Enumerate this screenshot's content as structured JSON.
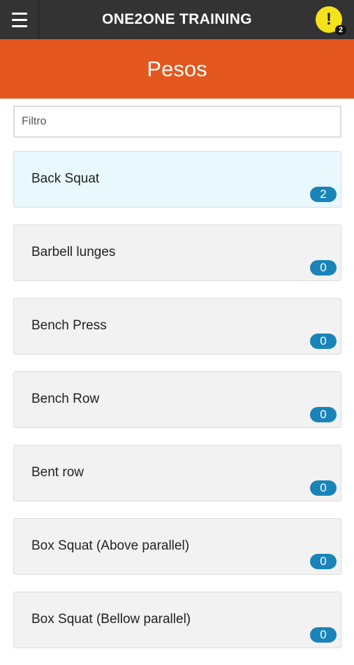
{
  "topbar": {
    "title": "ONE2ONE TRAINING",
    "menu_icon": "hamburger-icon",
    "alert_icon": "exclamation-icon",
    "alert_symbol": "!",
    "alert_count": "2",
    "background_color": "#333333",
    "alert_color": "#f5e21a"
  },
  "header": {
    "title": "Pesos",
    "background_color": "#e4571e"
  },
  "filter": {
    "placeholder": "Filtro",
    "value": ""
  },
  "exercises": [
    {
      "name": "Back Squat",
      "count": "2",
      "highlighted": true
    },
    {
      "name": "Barbell lunges",
      "count": "0"
    },
    {
      "name": "Bench Press",
      "count": "0"
    },
    {
      "name": "Bench Row",
      "count": "0"
    },
    {
      "name": "Bent row",
      "count": "0"
    },
    {
      "name": "Box Squat (Above parallel)",
      "count": "0"
    },
    {
      "name": "Box Squat (Bellow parallel)",
      "count": "0"
    }
  ],
  "colors": {
    "badge": "#1a84b8",
    "highlight": "#e9f8fd"
  }
}
